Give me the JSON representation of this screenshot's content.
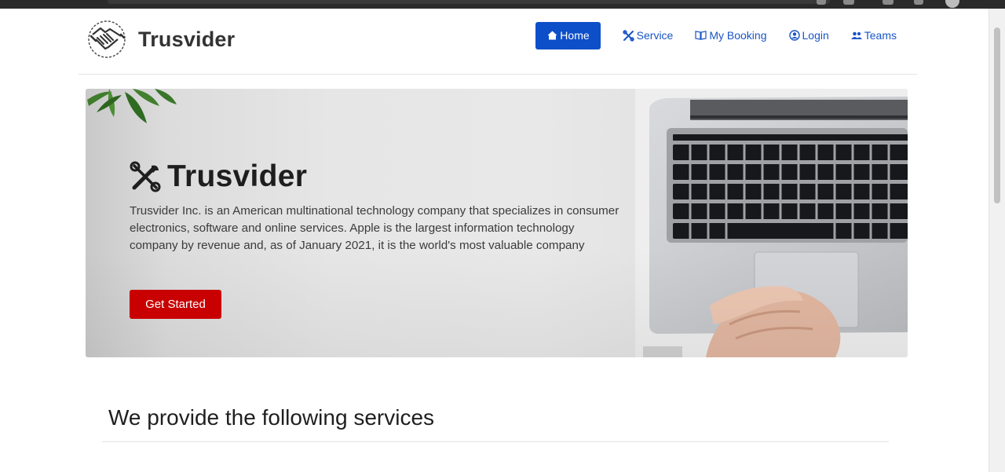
{
  "brand": {
    "name": "Trusvider"
  },
  "nav": {
    "items": [
      {
        "label": "Home",
        "icon": "home-icon",
        "active": true
      },
      {
        "label": "Service",
        "icon": "tools-icon"
      },
      {
        "label": "My Booking",
        "icon": "book-icon"
      },
      {
        "label": "Login",
        "icon": "user-circle-icon"
      },
      {
        "label": "Teams",
        "icon": "users-icon"
      }
    ]
  },
  "hero": {
    "title": "Trusvider",
    "description": "Trusvider Inc. is an American multinational technology company that specializes in consumer electronics, software and online services. Apple is the largest information technology company by revenue and, as of January 2021, it is the world's most valuable company",
    "cta_label": "Get Started"
  },
  "services": {
    "title": "We provide the following services"
  },
  "colors": {
    "primary": "#0d4fc8",
    "cta": "#c80000",
    "link": "#1a55c6"
  }
}
